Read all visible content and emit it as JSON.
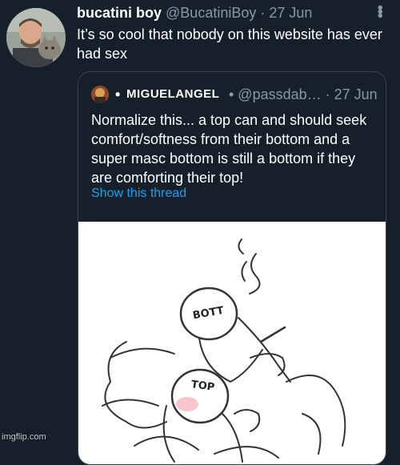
{
  "tweet": {
    "author_name": "bucatini boy",
    "author_handle": "@BucatiniBoy",
    "separator": "·",
    "date": "27 Jun",
    "more_icon": "more-vertical-icon",
    "text": "It’s so cool that nobody on this website has ever had sex"
  },
  "quoted_tweet": {
    "bullet": "•",
    "author_name": "MIGUELANGEL",
    "meta": "• @passdab… · 27 Jun",
    "text": "Normalize this... a top can and should seek comfort/softness from their bottom and a super masc bottom is still a bottom if they are comforting their top!",
    "show_thread": "Show this thread",
    "image": {
      "label_upper": "BOTT",
      "label_lower": "TOP"
    }
  },
  "watermark": "imgflip.com",
  "colors": {
    "background": "#15202b",
    "border": "#38444d",
    "muted": "#8899a6",
    "link": "#1da1f2"
  }
}
